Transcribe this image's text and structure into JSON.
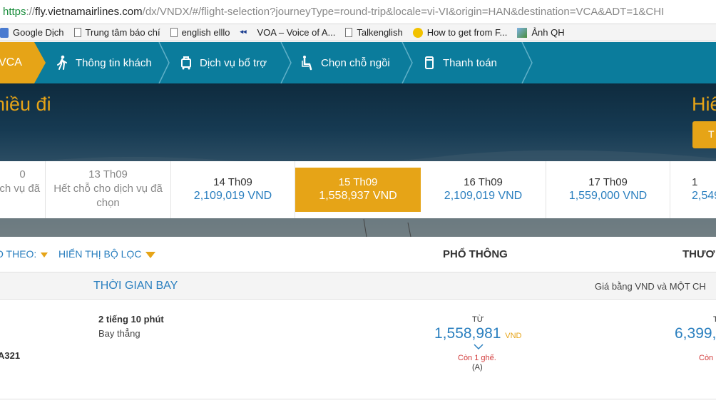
{
  "browser": {
    "url_scheme": "https",
    "url_sep": "://",
    "url_host": "fly.vietnamairlines.com",
    "url_path": "/dx/VNDX/#/flight-selection?journeyType=round-trip&locale=vi-VI&origin=HAN&destination=VCA&ADT=1&CHI"
  },
  "bookmarks": [
    {
      "label": "Google Dịch",
      "icon": "google-translate-icon"
    },
    {
      "label": "Trung tâm báo chí",
      "icon": "document-icon"
    },
    {
      "label": "english elllo",
      "icon": "document-icon"
    },
    {
      "label": "VOA – Voice of A...",
      "icon": "voa-icon"
    },
    {
      "label": "Talkenglish",
      "icon": "document-icon"
    },
    {
      "label": "How to get from F...",
      "icon": "taxi-icon"
    },
    {
      "label": "Ảnh QH",
      "icon": "image-icon"
    }
  ],
  "steps": {
    "current": "VCA",
    "items": [
      {
        "label": "Thông tin khách",
        "icon": "passenger-icon"
      },
      {
        "label": "Dịch vụ bổ trợ",
        "icon": "service-icon"
      },
      {
        "label": "Chọn chỗ ngồi",
        "icon": "seat-icon"
      },
      {
        "label": "Thanh toán",
        "icon": "payment-icon"
      }
    ]
  },
  "hero": {
    "title_left": "hiều đi",
    "title_right": "Hiể",
    "button_label": "T"
  },
  "dates": [
    {
      "date": "0",
      "price": "ịch vụ đã"
    },
    {
      "date": "13 Th09",
      "price": "Hết chỗ cho dịch vụ đã chọn"
    },
    {
      "date": "14 Th09",
      "price": "2,109,019 VND"
    },
    {
      "date": "15 Th09",
      "price": "1,558,937 VND"
    },
    {
      "date": "16 Th09",
      "price": "2,109,019 VND"
    },
    {
      "date": "17 Th09",
      "price": "1,559,000 VND"
    },
    {
      "date": "1",
      "price": "2,549"
    }
  ],
  "filter": {
    "sort_label": "O THEO:",
    "filter_label": "HIỂN THỊ BỘ LỌC",
    "class_economy": "PHỔ THÔNG",
    "class_premium": "THƯƠ"
  },
  "columns": {
    "flight_time": "THỜI GIAN BAY",
    "price_note": "Giá bằng VND và MỘT CH"
  },
  "flight": {
    "duration": "2 tiếng 10 phút",
    "stops": "Bay thẳng",
    "aircraft": "A321",
    "from_label": "TỪ",
    "price_economy": "1,558,981",
    "currency": "VND",
    "seats_left": "Còn 1 ghế.",
    "fare_class": "(A)",
    "price_premium": "6,399,",
    "seats_left_premium": "Còn",
    "premium_from_label": "T"
  },
  "colors": {
    "nav_blue": "#0b7c9c",
    "accent_gold": "#e6a417",
    "link_blue": "#2a7fbf",
    "alert_red": "#d23b3b"
  }
}
